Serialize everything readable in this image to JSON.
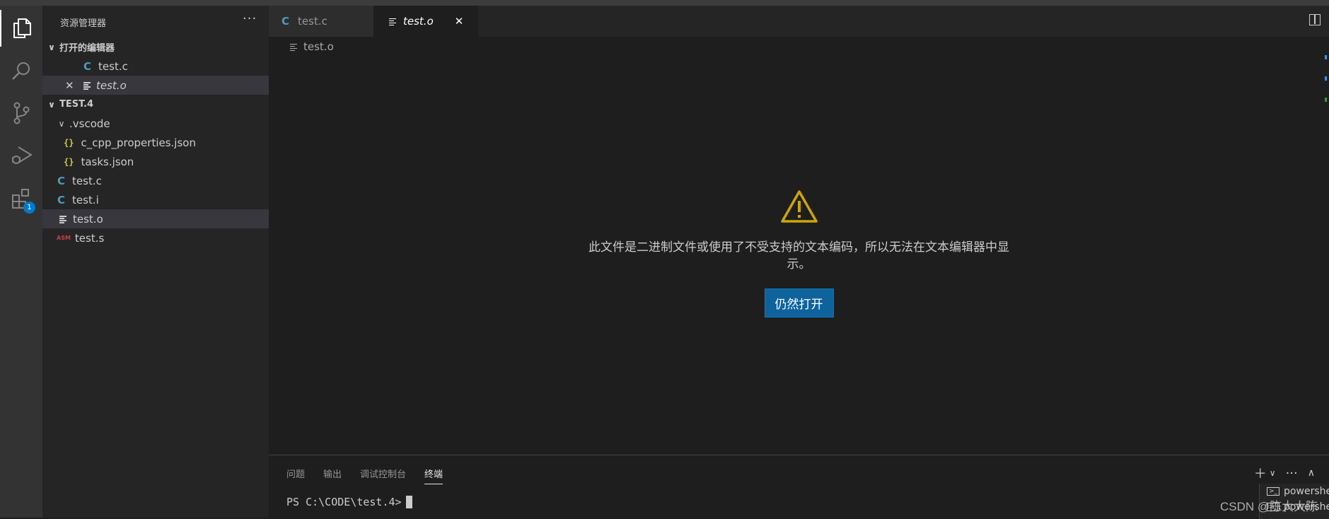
{
  "sidebar": {
    "title": "资源管理器",
    "more": "···",
    "open_editors": {
      "label": "打开的编辑器",
      "items": [
        {
          "icon": "C",
          "name": "test.c"
        },
        {
          "name": "test.o",
          "close": "✕"
        }
      ]
    },
    "workspace": {
      "label": "TEST.4",
      "folder": ".vscode",
      "folder_items": [
        {
          "icon": "{}",
          "name": "c_cpp_properties.json"
        },
        {
          "icon": "{}",
          "name": "tasks.json"
        }
      ],
      "files": [
        {
          "icon": "C",
          "name": "test.c"
        },
        {
          "icon": "C",
          "name": "test.i"
        },
        {
          "name": "test.o"
        },
        {
          "icon": "ASM",
          "name": "test.s"
        }
      ]
    }
  },
  "activity": {
    "extensions_badge": "1"
  },
  "editor": {
    "tabs": [
      {
        "icon": "C",
        "label": "test.c"
      },
      {
        "label": "test.o",
        "close": "✕"
      }
    ],
    "breadcrumb": "test.o",
    "warning_message": "此文件是二进制文件或使用了不受支持的文本编码，所以无法在文本编辑器中显示。",
    "open_anyway": "仍然打开"
  },
  "panel": {
    "tabs": [
      "问题",
      "输出",
      "调试控制台",
      "终端"
    ],
    "active_tab": "终端",
    "prompt": "PS C:\\CODE\\test.4>",
    "terminals": [
      "powershell",
      "powershell"
    ]
  },
  "watermark": "CSDN @陈大大陈",
  "colors": {
    "accent": "#007acc",
    "button": "#0e639c",
    "warning": "#cca700"
  }
}
